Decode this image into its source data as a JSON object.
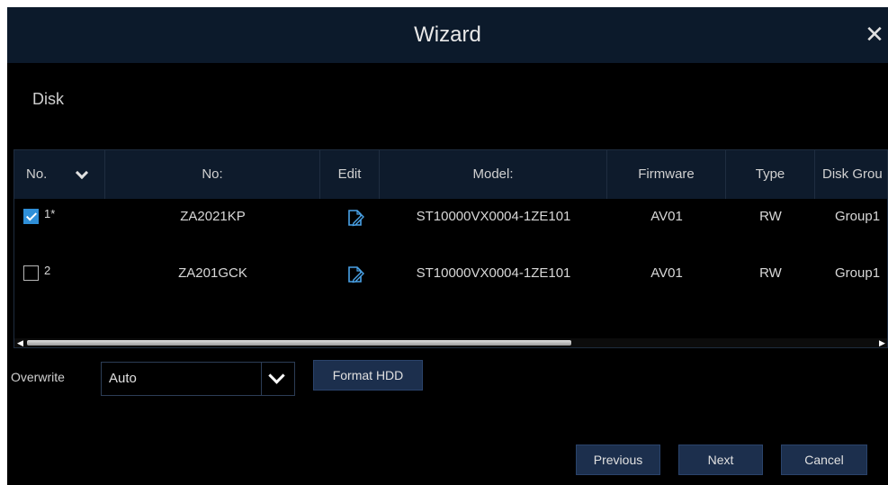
{
  "window": {
    "title": "Wizard"
  },
  "section_title": "Disk",
  "table": {
    "headers": [
      "No.",
      "No:",
      "Edit",
      "Model:",
      "Firmware",
      "Type",
      "Disk Grou"
    ],
    "rows": [
      {
        "checked": true,
        "no": "1*",
        "serial": "ZA2021KP",
        "model": "ST10000VX0004-1ZE101",
        "firmware": "AV01",
        "type": "RW",
        "group": "Group1"
      },
      {
        "checked": false,
        "no": "2",
        "serial": "ZA201GCK",
        "model": "ST10000VX0004-1ZE101",
        "firmware": "AV01",
        "type": "RW",
        "group": "Group1"
      }
    ],
    "scroll_fraction": 0.63
  },
  "overwrite": {
    "label": "Overwrite",
    "value": "Auto"
  },
  "buttons": {
    "format": "Format HDD",
    "previous": "Previous",
    "next": "Next",
    "cancel": "Cancel"
  },
  "icons": {
    "close": "close-icon",
    "sort": "chevron-down-icon",
    "edit": "edit-icon",
    "dropdown": "chevron-down-icon"
  },
  "colors": {
    "title_bar": "#0c1a2b",
    "header": "#0e1b2c",
    "accent": "#2f8fd8",
    "button": "#1c2f4d"
  }
}
